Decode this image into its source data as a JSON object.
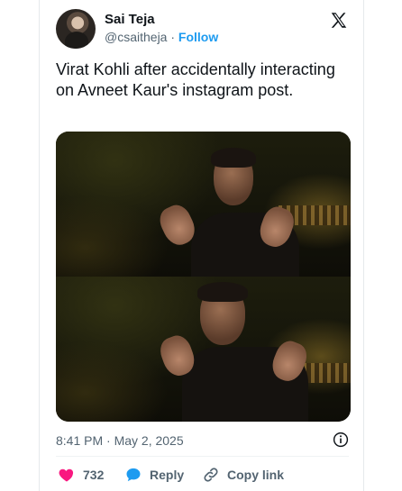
{
  "author": {
    "name": "Sai Teja",
    "handle": "@csaitheja",
    "separator": "·",
    "follow_label": "Follow"
  },
  "tweet": {
    "text": "Virat Kohli after accidentally interacting on Avneet Kaur's instagram post.",
    "timestamp": "8:41 PM · May 2, 2025"
  },
  "actions": {
    "likes_count": "732",
    "reply_label": "Reply",
    "copy_link_label": "Copy link"
  },
  "icons": {
    "brand": "x-logo-icon",
    "info": "info-icon",
    "like": "heart-icon",
    "reply": "speech-bubble-icon",
    "copy": "link-icon"
  },
  "colors": {
    "accent": "#1d9bf0",
    "like": "#f91880",
    "secondary_text": "#536471"
  }
}
